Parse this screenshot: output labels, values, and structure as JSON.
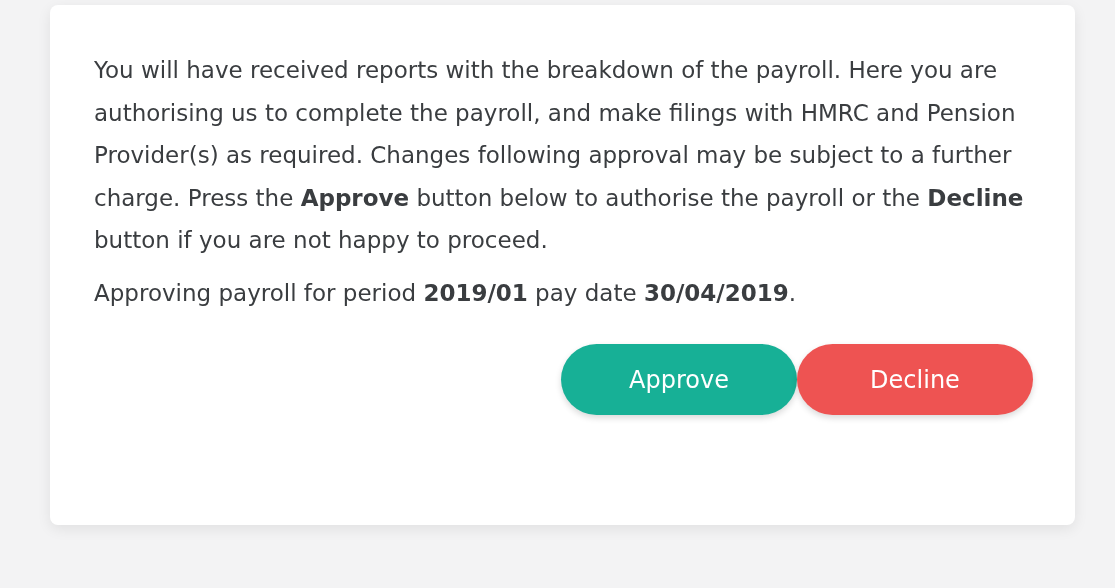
{
  "card": {
    "paragraphs": [
      "You will have received reports with the breakdown of the payroll. Here you are authorising us to complete the payroll, and make filings with HMRC and Pension Provider(s) as required. Changes following approval may be subject to a further charge. Press the **Approve** button below to authorise the payroll or the **Decline** button if you are not happy to proceed.",
      "Approving payroll for period **2019/01** pay date **30/04/2019**."
    ],
    "buttons": [
      {
        "label": "Approve",
        "kind": "approve"
      },
      {
        "label": "Decline",
        "kind": "decline"
      }
    ]
  }
}
